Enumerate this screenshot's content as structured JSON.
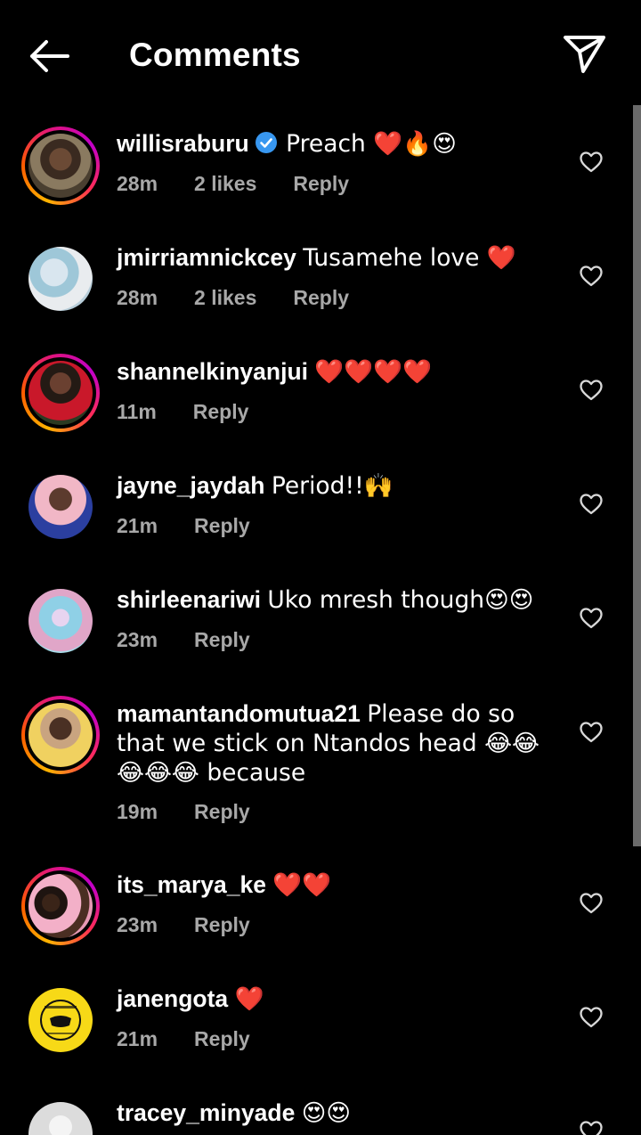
{
  "header": {
    "title": "Comments",
    "back_icon": "arrow-left-icon",
    "send_icon": "paper-plane-icon"
  },
  "colors": {
    "background": "#000000",
    "meta_text": "#a8a8a8",
    "verified_blue": "#3897f0",
    "heart_red": "#e8112d"
  },
  "comments": [
    {
      "username": "willisraburu",
      "verified": true,
      "text": "Preach ❤️🔥😍",
      "time": "28m",
      "likes": "2 likes",
      "reply": "Reply",
      "story_ring": true
    },
    {
      "username": "jmirriamnickcey",
      "verified": false,
      "text": "Tusamehe love ❤️",
      "time": "28m",
      "likes": "2 likes",
      "reply": "Reply",
      "story_ring": false
    },
    {
      "username": "shannelkinyanjui",
      "verified": false,
      "text": "❤️❤️❤️❤️",
      "time": "11m",
      "likes": "",
      "reply": "Reply",
      "story_ring": true
    },
    {
      "username": "jayne_jaydah",
      "verified": false,
      "text": "Period!!🙌",
      "time": "21m",
      "likes": "",
      "reply": "Reply",
      "story_ring": false
    },
    {
      "username": "shirleenariwi",
      "verified": false,
      "text": "Uko mresh though😍😍",
      "time": "23m",
      "likes": "",
      "reply": "Reply",
      "story_ring": false
    },
    {
      "username": "mamantandomutua21",
      "verified": false,
      "text": "Please do so that we stick on Ntandos head 😂😂😂😂😂 because",
      "time": "19m",
      "likes": "",
      "reply": "Reply",
      "story_ring": true
    },
    {
      "username": "its_marya_ke",
      "verified": false,
      "text": "❤️❤️",
      "time": "23m",
      "likes": "",
      "reply": "Reply",
      "story_ring": true
    },
    {
      "username": "janengota",
      "verified": false,
      "text": "❤️",
      "time": "21m",
      "likes": "",
      "reply": "Reply",
      "story_ring": false
    },
    {
      "username": "tracey_minyade",
      "verified": false,
      "text": "😍😍",
      "time": "",
      "likes": "",
      "reply": "",
      "story_ring": false
    }
  ]
}
